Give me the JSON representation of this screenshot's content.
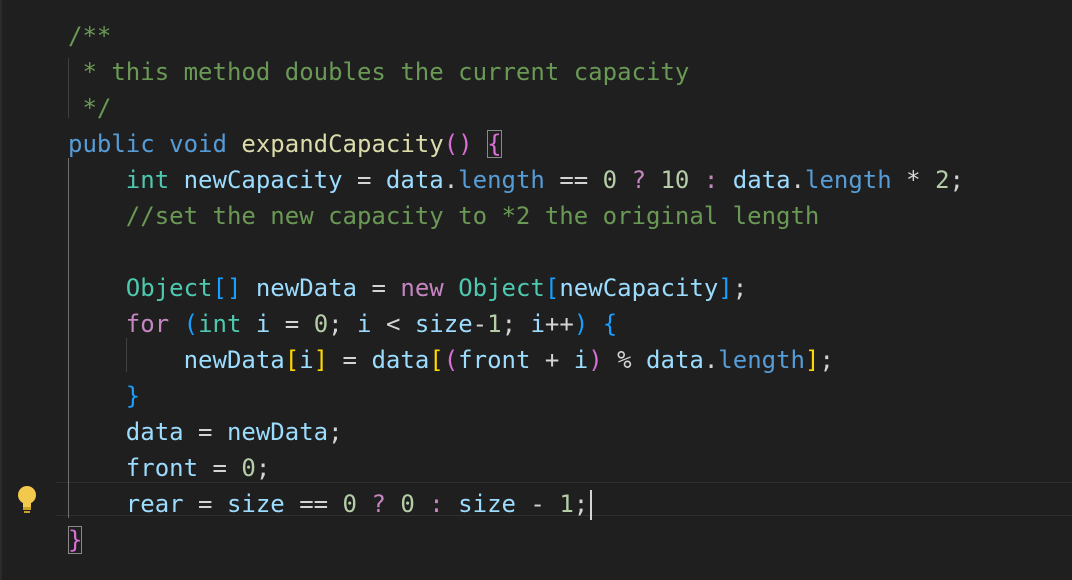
{
  "editor": {
    "lines": [
      {
        "tokens": [
          {
            "text": "/**",
            "cls": "c"
          }
        ]
      },
      {
        "tokens": [
          {
            "text": " * this method doubles the current capacity",
            "cls": "c"
          }
        ]
      },
      {
        "tokens": [
          {
            "text": " */",
            "cls": "c"
          }
        ]
      },
      {
        "tokens": [
          {
            "text": "public",
            "cls": "k"
          },
          {
            "text": " ",
            "cls": "p"
          },
          {
            "text": "void",
            "cls": "k"
          },
          {
            "text": " ",
            "cls": "p"
          },
          {
            "text": "expandCapacity",
            "cls": "m"
          },
          {
            "text": "()",
            "cls": "pk"
          },
          {
            "text": " ",
            "cls": "p"
          },
          {
            "text": "{",
            "cls": "pk",
            "box": true
          }
        ]
      },
      {
        "tokens": [
          {
            "text": "    ",
            "cls": "p"
          },
          {
            "text": "int",
            "cls": "t"
          },
          {
            "text": " ",
            "cls": "p"
          },
          {
            "text": "newCapacity",
            "cls": "v"
          },
          {
            "text": " = ",
            "cls": "p"
          },
          {
            "text": "data",
            "cls": "v"
          },
          {
            "text": ".",
            "cls": "p"
          },
          {
            "text": "length",
            "cls": "k"
          },
          {
            "text": " == ",
            "cls": "p"
          },
          {
            "text": "0",
            "cls": "n"
          },
          {
            "text": " ? ",
            "cls": "ctl"
          },
          {
            "text": "10",
            "cls": "n"
          },
          {
            "text": " : ",
            "cls": "ctl"
          },
          {
            "text": "data",
            "cls": "v"
          },
          {
            "text": ".",
            "cls": "p"
          },
          {
            "text": "length",
            "cls": "k"
          },
          {
            "text": " * ",
            "cls": "p"
          },
          {
            "text": "2",
            "cls": "n"
          },
          {
            "text": ";",
            "cls": "p"
          }
        ]
      },
      {
        "tokens": [
          {
            "text": "    //set the new capacity to *2 the original length",
            "cls": "c"
          }
        ]
      },
      {
        "tokens": []
      },
      {
        "tokens": [
          {
            "text": "    ",
            "cls": "p"
          },
          {
            "text": "Object",
            "cls": "t"
          },
          {
            "text": "[]",
            "cls": "bl"
          },
          {
            "text": " ",
            "cls": "p"
          },
          {
            "text": "newData",
            "cls": "v"
          },
          {
            "text": " = ",
            "cls": "p"
          },
          {
            "text": "new",
            "cls": "ctl"
          },
          {
            "text": " ",
            "cls": "p"
          },
          {
            "text": "Object",
            "cls": "t"
          },
          {
            "text": "[",
            "cls": "bl"
          },
          {
            "text": "newCapacity",
            "cls": "v"
          },
          {
            "text": "]",
            "cls": "bl"
          },
          {
            "text": ";",
            "cls": "p"
          }
        ]
      },
      {
        "tokens": [
          {
            "text": "    ",
            "cls": "p"
          },
          {
            "text": "for",
            "cls": "ctl"
          },
          {
            "text": " ",
            "cls": "p"
          },
          {
            "text": "(",
            "cls": "bl"
          },
          {
            "text": "int",
            "cls": "t"
          },
          {
            "text": " ",
            "cls": "p"
          },
          {
            "text": "i",
            "cls": "v"
          },
          {
            "text": " = ",
            "cls": "p"
          },
          {
            "text": "0",
            "cls": "n"
          },
          {
            "text": "; ",
            "cls": "p"
          },
          {
            "text": "i",
            "cls": "v"
          },
          {
            "text": " < ",
            "cls": "p"
          },
          {
            "text": "size",
            "cls": "v"
          },
          {
            "text": "-",
            "cls": "p"
          },
          {
            "text": "1",
            "cls": "n"
          },
          {
            "text": "; ",
            "cls": "p"
          },
          {
            "text": "i",
            "cls": "v"
          },
          {
            "text": "++",
            "cls": "p"
          },
          {
            "text": ")",
            "cls": "bl"
          },
          {
            "text": " ",
            "cls": "p"
          },
          {
            "text": "{",
            "cls": "bl"
          }
        ]
      },
      {
        "tokens": [
          {
            "text": "        ",
            "cls": "p"
          },
          {
            "text": "newData",
            "cls": "v"
          },
          {
            "text": "[",
            "cls": "y"
          },
          {
            "text": "i",
            "cls": "v"
          },
          {
            "text": "]",
            "cls": "y"
          },
          {
            "text": " = ",
            "cls": "p"
          },
          {
            "text": "data",
            "cls": "v"
          },
          {
            "text": "[",
            "cls": "y"
          },
          {
            "text": "(",
            "cls": "pk"
          },
          {
            "text": "front",
            "cls": "v"
          },
          {
            "text": " + ",
            "cls": "p"
          },
          {
            "text": "i",
            "cls": "v"
          },
          {
            "text": ")",
            "cls": "pk"
          },
          {
            "text": " % ",
            "cls": "p"
          },
          {
            "text": "data",
            "cls": "v"
          },
          {
            "text": ".",
            "cls": "p"
          },
          {
            "text": "length",
            "cls": "k"
          },
          {
            "text": "]",
            "cls": "y"
          },
          {
            "text": ";",
            "cls": "p"
          }
        ]
      },
      {
        "tokens": [
          {
            "text": "    ",
            "cls": "p"
          },
          {
            "text": "}",
            "cls": "bl"
          }
        ]
      },
      {
        "tokens": [
          {
            "text": "    ",
            "cls": "p"
          },
          {
            "text": "data",
            "cls": "v"
          },
          {
            "text": " = ",
            "cls": "p"
          },
          {
            "text": "newData",
            "cls": "v"
          },
          {
            "text": ";",
            "cls": "p"
          }
        ]
      },
      {
        "tokens": [
          {
            "text": "    ",
            "cls": "p"
          },
          {
            "text": "front",
            "cls": "v"
          },
          {
            "text": " = ",
            "cls": "p"
          },
          {
            "text": "0",
            "cls": "n"
          },
          {
            "text": ";",
            "cls": "p"
          }
        ]
      },
      {
        "tokens": [
          {
            "text": "    ",
            "cls": "p"
          },
          {
            "text": "rear",
            "cls": "v"
          },
          {
            "text": " = ",
            "cls": "p"
          },
          {
            "text": "size",
            "cls": "v"
          },
          {
            "text": " == ",
            "cls": "p"
          },
          {
            "text": "0",
            "cls": "n"
          },
          {
            "text": " ? ",
            "cls": "ctl"
          },
          {
            "text": "0",
            "cls": "n"
          },
          {
            "text": " : ",
            "cls": "ctl"
          },
          {
            "text": "size",
            "cls": "v"
          },
          {
            "text": " - ",
            "cls": "p"
          },
          {
            "text": "1",
            "cls": "n"
          },
          {
            "text": ";",
            "cls": "p"
          }
        ],
        "cursor": true
      },
      {
        "tokens": [
          {
            "text": "}",
            "cls": "pk",
            "box": true
          }
        ]
      }
    ],
    "icons": {
      "gutter": "lightbulb-icon"
    }
  }
}
